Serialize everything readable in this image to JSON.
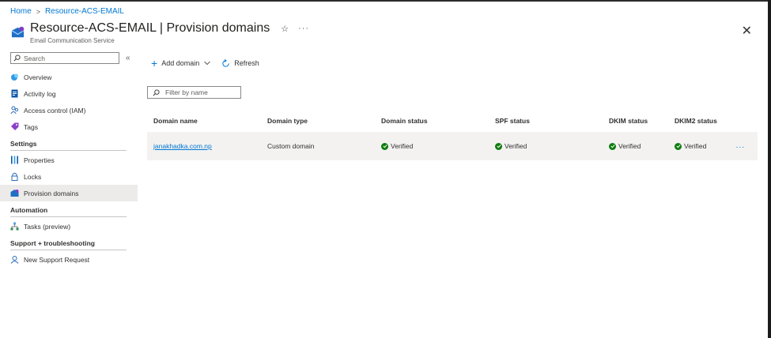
{
  "breadcrumb": {
    "home": "Home",
    "resource": "Resource-ACS-EMAIL",
    "separator": ">"
  },
  "header": {
    "title": "Resource-ACS-EMAIL | Provision domains",
    "subtitle": "Email Communication Service",
    "star": "☆",
    "more": "···",
    "close": "✕"
  },
  "sidebar": {
    "search_placeholder": "Search",
    "collapse": "«",
    "items": [
      {
        "label": "Overview",
        "icon": "overview-icon"
      },
      {
        "label": "Activity log",
        "icon": "activity-log-icon"
      },
      {
        "label": "Access control (IAM)",
        "icon": "people-icon"
      },
      {
        "label": "Tags",
        "icon": "tag-icon"
      }
    ],
    "sections": [
      {
        "label": "Settings",
        "items": [
          {
            "label": "Properties",
            "icon": "properties-icon"
          },
          {
            "label": "Locks",
            "icon": "lock-icon"
          },
          {
            "label": "Provision domains",
            "icon": "domains-icon",
            "active": true
          }
        ]
      },
      {
        "label": "Automation",
        "items": [
          {
            "label": "Tasks (preview)",
            "icon": "tasks-icon"
          }
        ]
      },
      {
        "label": "Support + troubleshooting",
        "items": [
          {
            "label": "New Support Request",
            "icon": "support-icon"
          }
        ]
      }
    ]
  },
  "toolbar": {
    "add_domain": "Add domain",
    "refresh": "Refresh"
  },
  "filter": {
    "placeholder": "Filter by name"
  },
  "table": {
    "columns": [
      "Domain name",
      "Domain type",
      "Domain status",
      "SPF status",
      "DKIM status",
      "DKIM2 status"
    ],
    "rows": [
      {
        "domain_name": "janakhadka.com.np",
        "domain_type": "Custom domain",
        "domain_status": "Verified",
        "spf_status": "Verified",
        "dkim_status": "Verified",
        "dkim2_status": "Verified",
        "more": "..."
      }
    ]
  },
  "colors": {
    "accent": "#0078d4",
    "verified": "#107c10",
    "active_bg": "#edebe9"
  }
}
